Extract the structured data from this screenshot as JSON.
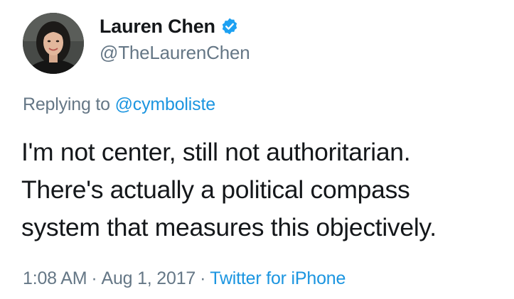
{
  "author": {
    "display_name": "Lauren Chen",
    "handle": "@TheLaurenChen",
    "verified": true,
    "verified_icon": "verified-badge-icon",
    "verified_color": "#1da1f2"
  },
  "reply": {
    "prefix": "Replying to",
    "mention": "@cymboliste"
  },
  "tweet": {
    "lines": [
      "I'm not center, still not authoritarian.",
      "There's actually a political compass",
      "system that measures this objectively."
    ]
  },
  "meta": {
    "time": "1:08 AM",
    "separator": "·",
    "date": "Aug 1, 2017",
    "source": "Twitter for iPhone"
  },
  "colors": {
    "text": "#14171a",
    "secondary": "#657786",
    "link": "#1b95e0"
  }
}
